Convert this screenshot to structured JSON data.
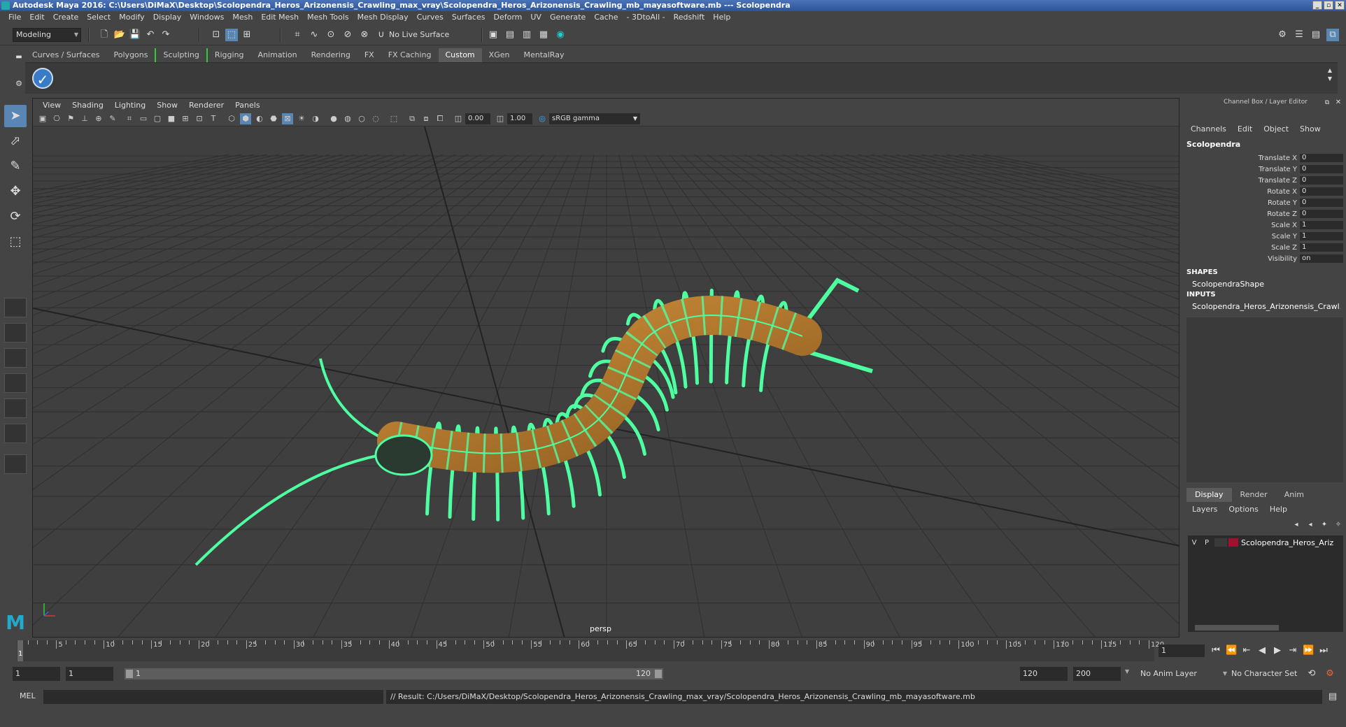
{
  "window": {
    "title": "Autodesk Maya 2016: C:\\Users\\DiMaX\\Desktop\\Scolopendra_Heros_Arizonensis_Crawling_max_vray\\Scolopendra_Heros_Arizonensis_Crawling_mb_mayasoftware.mb  ---  Scolopendra"
  },
  "menubar": [
    "File",
    "Edit",
    "Create",
    "Select",
    "Modify",
    "Display",
    "Windows",
    "Mesh",
    "Edit Mesh",
    "Mesh Tools",
    "Mesh Display",
    "Curves",
    "Surfaces",
    "Deform",
    "UV",
    "Generate",
    "Cache",
    "- 3DtoAll -",
    "Redshift",
    "Help"
  ],
  "statusline": {
    "mode": "Modeling",
    "live_surface": "No Live Surface"
  },
  "shelf": {
    "tabs": [
      "Curves / Surfaces",
      "Polygons",
      "Sculpting",
      "Rigging",
      "Animation",
      "Rendering",
      "FX",
      "FX Caching",
      "Custom",
      "XGen",
      "MentalRay"
    ],
    "active_tab": "Custom"
  },
  "viewport": {
    "menu": [
      "View",
      "Shading",
      "Lighting",
      "Show",
      "Renderer",
      "Panels"
    ],
    "exposure": "0.00",
    "gamma": "1.00",
    "color_space": "sRGB gamma",
    "camera": "persp"
  },
  "channelbox": {
    "title": "Channel Box / Layer Editor",
    "menu": [
      "Channels",
      "Edit",
      "Object",
      "Show"
    ],
    "object": "Scolopendra",
    "attributes": [
      {
        "name": "Translate X",
        "value": "0"
      },
      {
        "name": "Translate Y",
        "value": "0"
      },
      {
        "name": "Translate Z",
        "value": "0"
      },
      {
        "name": "Rotate X",
        "value": "0"
      },
      {
        "name": "Rotate Y",
        "value": "0"
      },
      {
        "name": "Rotate Z",
        "value": "0"
      },
      {
        "name": "Scale X",
        "value": "1"
      },
      {
        "name": "Scale Y",
        "value": "1"
      },
      {
        "name": "Scale Z",
        "value": "1"
      },
      {
        "name": "Visibility",
        "value": "on"
      }
    ],
    "shapes_label": "SHAPES",
    "shape": "ScolopendraShape",
    "inputs_label": "INPUTS",
    "input": "Scolopendra_Heros_Arizonensis_Crawl..."
  },
  "layers": {
    "tabs": [
      "Display",
      "Render",
      "Anim"
    ],
    "active_tab": "Display",
    "menu": [
      "Layers",
      "Options",
      "Help"
    ],
    "row": {
      "v": "V",
      "p": "P",
      "name": "Scolopendra_Heros_Ariz",
      "color": "#a01030"
    }
  },
  "timeline": {
    "labels": [
      "5",
      "10",
      "15",
      "20",
      "25",
      "30",
      "35",
      "40",
      "45",
      "50",
      "55",
      "60",
      "65",
      "70",
      "75",
      "80",
      "85",
      "90",
      "95",
      "100",
      "105",
      "110",
      "115",
      "120"
    ],
    "current": "1",
    "frame_field": "1"
  },
  "range": {
    "start": "1",
    "anim_start": "1",
    "slider_start": "1",
    "slider_end": "120",
    "end": "120",
    "anim_end": "200",
    "anim_layer": "No Anim Layer",
    "character_set": "No Character Set"
  },
  "cmdline": {
    "lang": "MEL",
    "result": "// Result: C:/Users/DiMaX/Desktop/Scolopendra_Heros_Arizonensis_Crawling_max_vray/Scolopendra_Heros_Arizonensis_Crawling_mb_mayasoftware.mb"
  },
  "colors": {
    "wireframe": "#4dffa0",
    "body": "#c88a3a",
    "selection_blue": "#5a86b3"
  }
}
